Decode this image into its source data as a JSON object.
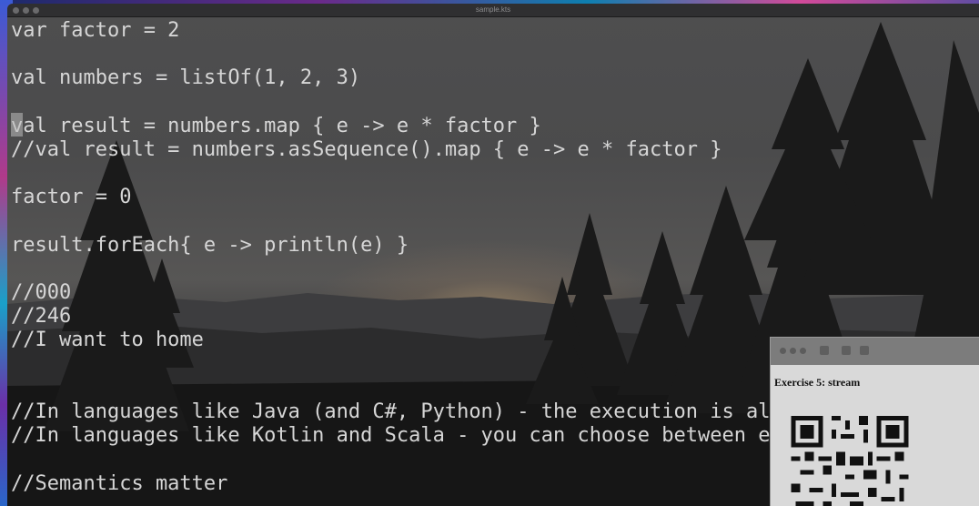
{
  "window": {
    "title": "sample.kts"
  },
  "editor": {
    "lines": [
      "var factor = 2",
      "",
      "val numbers = listOf(1, 2, 3)",
      "",
      "val result = numbers.map { e -> e * factor }",
      "//val result = numbers.asSequence().map { e -> e * factor }",
      "",
      "factor = 0",
      "",
      "result.forEach{ e -> println(e) }",
      "",
      "//000",
      "//246",
      "//I want to home",
      "",
      "",
      "//In languages like Java (and C#, Python) - the execution is always lazy",
      "//In languages like Kotlin and Scala - you can choose between eager and lazy",
      "",
      "//Semantics matter"
    ]
  },
  "preview": {
    "title": "Exercise 5: stream"
  }
}
